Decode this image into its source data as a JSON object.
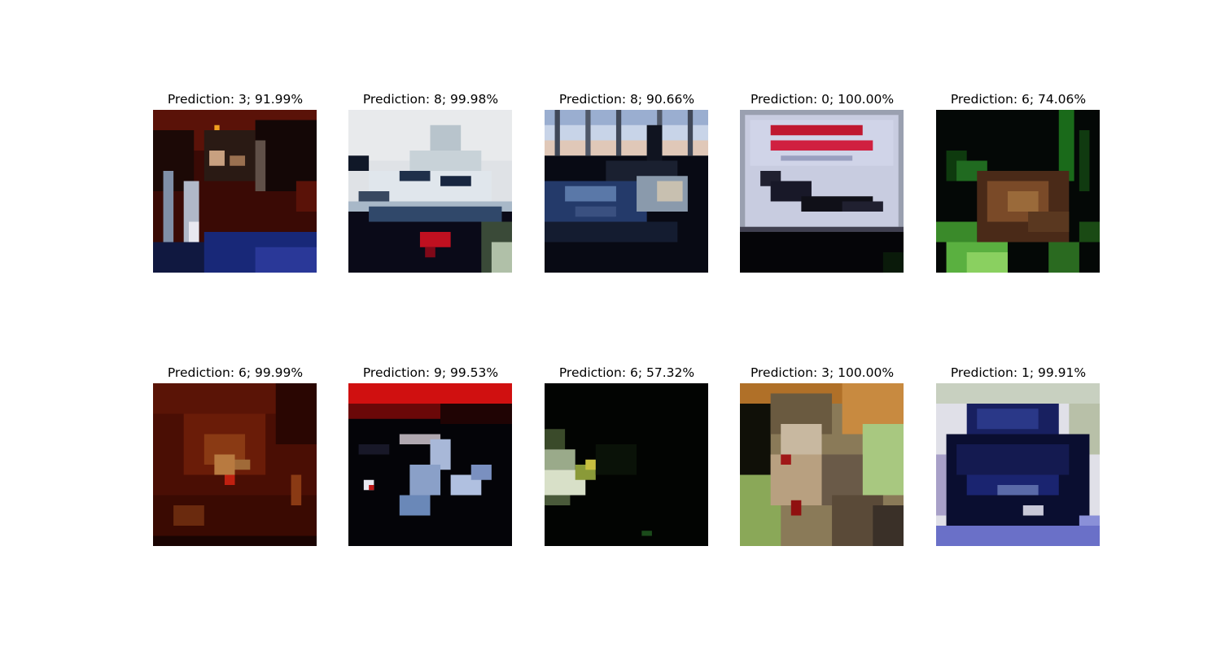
{
  "panels": [
    {
      "title": "Prediction: 3; 91.99%",
      "prediction": 3,
      "confidence_pct": 91.99,
      "icon": "cifar-thumbnail-cat-dark-red"
    },
    {
      "title": "Prediction: 8; 99.98%",
      "prediction": 8,
      "confidence_pct": 99.98,
      "icon": "cifar-thumbnail-ship-white"
    },
    {
      "title": "Prediction: 8; 90.66%",
      "prediction": 8,
      "confidence_pct": 90.66,
      "icon": "cifar-thumbnail-ship-harbor"
    },
    {
      "title": "Prediction: 0; 100.00%",
      "prediction": 0,
      "confidence_pct": 100.0,
      "icon": "cifar-thumbnail-airplane-sign"
    },
    {
      "title": "Prediction: 6; 74.06%",
      "prediction": 6,
      "confidence_pct": 74.06,
      "icon": "cifar-thumbnail-frog-grass"
    },
    {
      "title": "Prediction: 6; 99.99%",
      "prediction": 6,
      "confidence_pct": 99.99,
      "icon": "cifar-thumbnail-frog-red"
    },
    {
      "title": "Prediction: 9; 99.53%",
      "prediction": 9,
      "confidence_pct": 99.53,
      "icon": "cifar-thumbnail-truck-dark"
    },
    {
      "title": "Prediction: 6; 57.32%",
      "prediction": 6,
      "confidence_pct": 57.32,
      "icon": "cifar-thumbnail-frog-dark"
    },
    {
      "title": "Prediction: 3; 100.00%",
      "prediction": 3,
      "confidence_pct": 100.0,
      "icon": "cifar-thumbnail-cat-green"
    },
    {
      "title": "Prediction: 1; 99.91%",
      "prediction": 1,
      "confidence_pct": 99.91,
      "icon": "cifar-thumbnail-car-blue"
    }
  ]
}
